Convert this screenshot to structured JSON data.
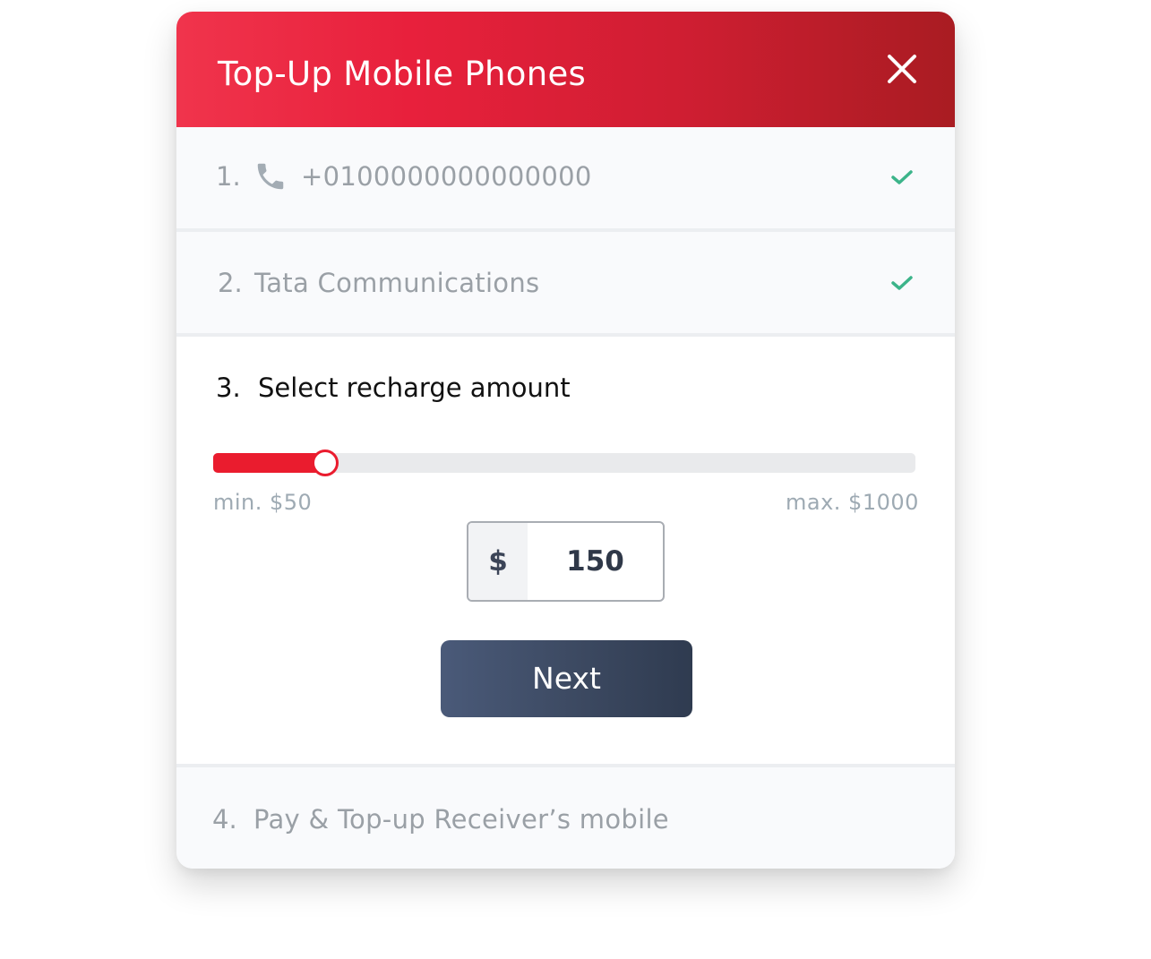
{
  "header": {
    "title": "Top-Up Mobile Phones",
    "close_icon": "close-icon"
  },
  "steps": [
    {
      "number": "1.",
      "icon": "phone-icon",
      "text": "+0100000000000000",
      "status": "complete",
      "status_icon": "check-icon"
    },
    {
      "number": "2.",
      "text": "Tata Communications",
      "status": "complete",
      "status_icon": "check-icon"
    },
    {
      "number": "3.",
      "text": "Select recharge amount",
      "status": "active"
    },
    {
      "number": "4.",
      "text": "Pay & Top-up Receiver’s mobile",
      "status": "pending"
    }
  ],
  "amount": {
    "min_label": "min. $50",
    "max_label": "max. $1000",
    "min": 50,
    "max": 1000,
    "value": 150,
    "currency_symbol": "$",
    "value_display": "150"
  },
  "actions": {
    "next_label": "Next"
  },
  "colors": {
    "header_start": "#f0344c",
    "header_end": "#a91c22",
    "accent": "#ea1c2e",
    "check": "#3cb48a",
    "button": "#3c4961"
  }
}
